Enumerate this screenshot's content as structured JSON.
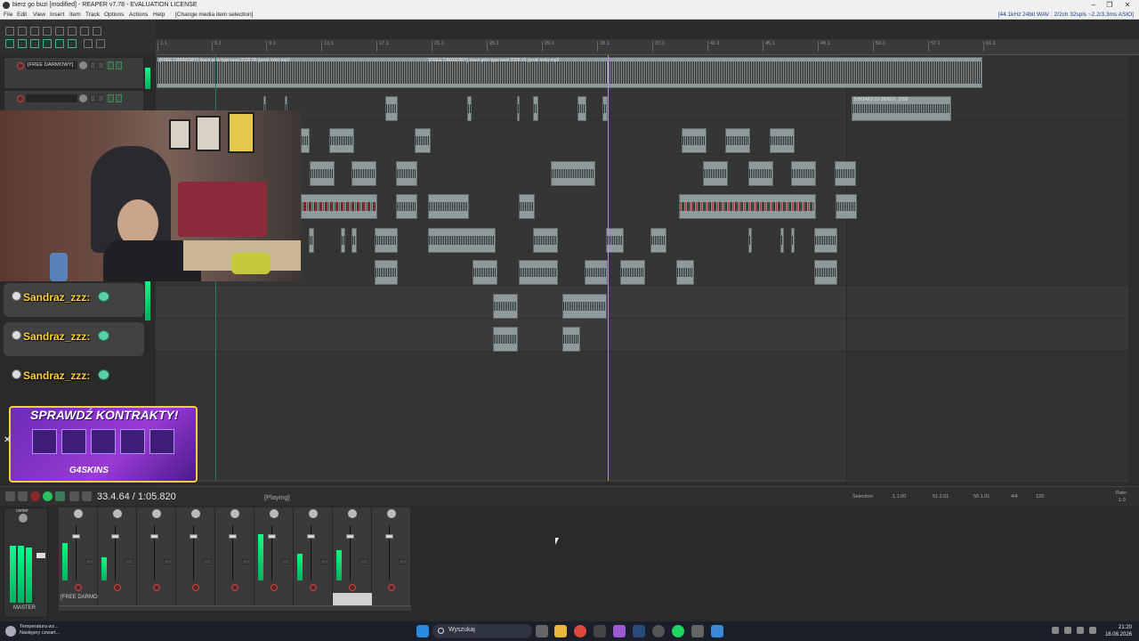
{
  "window": {
    "title": "bierz go buzi [modified] - REAPER v7.78 - EVALUATION LICENSE",
    "controls": [
      "–",
      "❐",
      "✕"
    ]
  },
  "menu": {
    "items": [
      "File",
      "Edit",
      "View",
      "Insert",
      "Item",
      "Track",
      "Options",
      "Actions",
      "Help",
      "[Change media item selection]"
    ],
    "status_right": "[44.1kHz 24bit WAV : 2/2ch 32spls ~2.2/3.3ms ASIO]"
  },
  "ruler": {
    "ticks": [
      "1.1",
      "5.1",
      "9.1",
      "13.1",
      "17.1",
      "21.1",
      "25.1",
      "29.1",
      "33.1",
      "37.1",
      "41.1",
      "45.1",
      "49.1",
      "53.1",
      "57.1",
      "61.1"
    ]
  },
  "tracks": [
    {
      "name": "[FREE DARMOWY]"
    },
    {
      "name": ""
    }
  ],
  "items": {
    "main_label": "[FREE DARMOWY] disco polo type beat 2026 #5 (prod. krtx).mp3",
    "main_label_2": "[FREE DARMOWY] disco polo type beat 2026 #5 (prod. krtx).mp3",
    "sample_label": "5 BOAR3 03-260816_2059"
  },
  "chat": {
    "names": [
      "Sandraz_zzz:",
      "Sandraz_zzz:",
      "Sandraz_zzz:"
    ]
  },
  "promo": {
    "title": "SPRAWDŹ KONTRAKTY!",
    "brand": "G4SKINS",
    "close": "✕"
  },
  "transport": {
    "time": "33.4.64 / 1:05.820",
    "state": "[Playing]",
    "selection_label": "Selection:",
    "sel_start": "1.1.00",
    "sel_end": "51.2.01",
    "sel_len": "50.1.01",
    "timesig": "4/4",
    "bpm": "120",
    "rate_label": "Rate:",
    "rate": "1.0"
  },
  "mixer": {
    "track_label": "[FREE DARMO",
    "master_label": "MASTER",
    "master_pan": "center"
  },
  "taskbar": {
    "weather_line1": "Temperatura wz...",
    "weather_line2": "Następny czwart...",
    "search_placeholder": "Wyszukaj",
    "time": "21:20",
    "date": "16.08.2026"
  },
  "colors": {
    "meter_green": "#00ff80",
    "play_cursor": "#c8a24a",
    "chat_name": "#ffd23a",
    "promo_bg": "#7a2fc4"
  }
}
